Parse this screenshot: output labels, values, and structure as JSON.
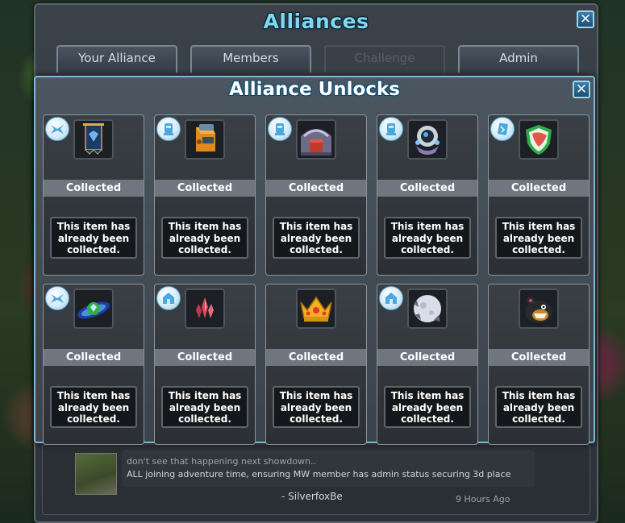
{
  "window": {
    "title": "Alliances",
    "close_glyph": "✕",
    "tabs": [
      {
        "label": "Your Alliance",
        "enabled": true
      },
      {
        "label": "Members",
        "enabled": true
      },
      {
        "label": "Challenge",
        "enabled": false
      },
      {
        "label": "Admin",
        "enabled": true
      }
    ]
  },
  "news": {
    "line1": "don't see that happening next showdown..",
    "line2": "ALL joining adventure time, ensuring MW member has admin status securing 3d place",
    "author": "- SilverfoxBe",
    "time": "9 Hours Ago"
  },
  "dialog": {
    "title": "Alliance Unlocks",
    "close_glyph": "✕",
    "items": [
      {
        "icon": "banner-icon",
        "badge": "spaceship-badge-icon",
        "status": "Collected",
        "message": "This item has already been collected."
      },
      {
        "icon": "cannon-turret-icon",
        "badge": "droid-badge-icon",
        "status": "Collected",
        "message": "This item has already been collected."
      },
      {
        "icon": "armory-building-icon",
        "badge": "droid-badge-icon",
        "status": "Collected",
        "message": "This item has already been collected."
      },
      {
        "icon": "space-pod-icon",
        "badge": "droid-badge-icon",
        "status": "Collected",
        "message": "This item has already been collected."
      },
      {
        "icon": "shield-icon",
        "badge": "item-badge-icon",
        "status": "Collected",
        "message": "This item has already been collected."
      },
      {
        "icon": "planet-ring-icon",
        "badge": "spaceship-badge-icon",
        "status": "Collected",
        "message": "This item has already been collected."
      },
      {
        "icon": "red-crystal-icon",
        "badge": "building-badge-icon",
        "status": "Collected",
        "message": "This item has already been collected."
      },
      {
        "icon": "crown-icon",
        "badge": "",
        "status": "Collected",
        "message": "This item has already been collected."
      },
      {
        "icon": "moon-orb-icon",
        "badge": "building-badge-icon",
        "status": "Collected",
        "message": "This item has already been collected."
      },
      {
        "icon": "black-pet-creature-icon",
        "badge": "",
        "status": "Collected",
        "message": "This item has already been collected."
      }
    ]
  },
  "colors": {
    "title_blue": "#7fd8f2",
    "dialog_border": "#7fb9d9",
    "badge_fill": "#cfe9f7",
    "status_band": "#6f7680"
  }
}
